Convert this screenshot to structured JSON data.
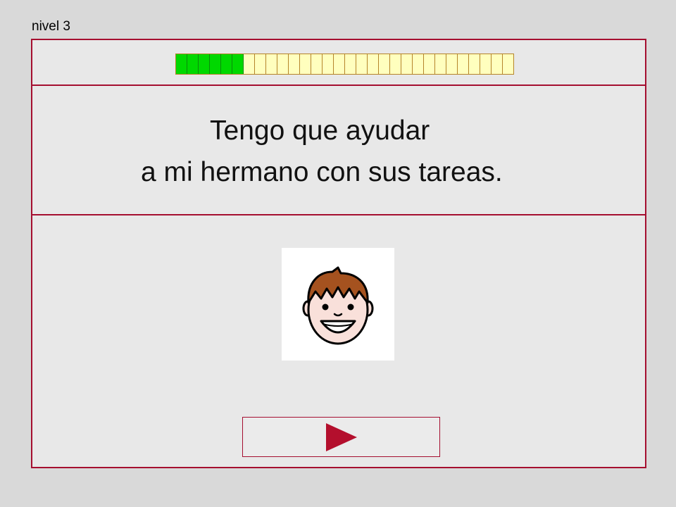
{
  "header": {
    "level_label": "nivel 3"
  },
  "progress": {
    "completed": 6,
    "total": 30
  },
  "sentence": {
    "line1": "Tengo que ayudar",
    "line2": "a mi hermano con sus tareas."
  },
  "picture": {
    "icon": "smiling-boy-face-icon"
  },
  "navigation": {
    "next_icon": "play-arrow-icon"
  },
  "colors": {
    "border": "#a50f30",
    "progress_done": "#00d800",
    "progress_pending": "#ffffbe",
    "background": "#d9d9d9",
    "panel": "#e8e8e8"
  }
}
